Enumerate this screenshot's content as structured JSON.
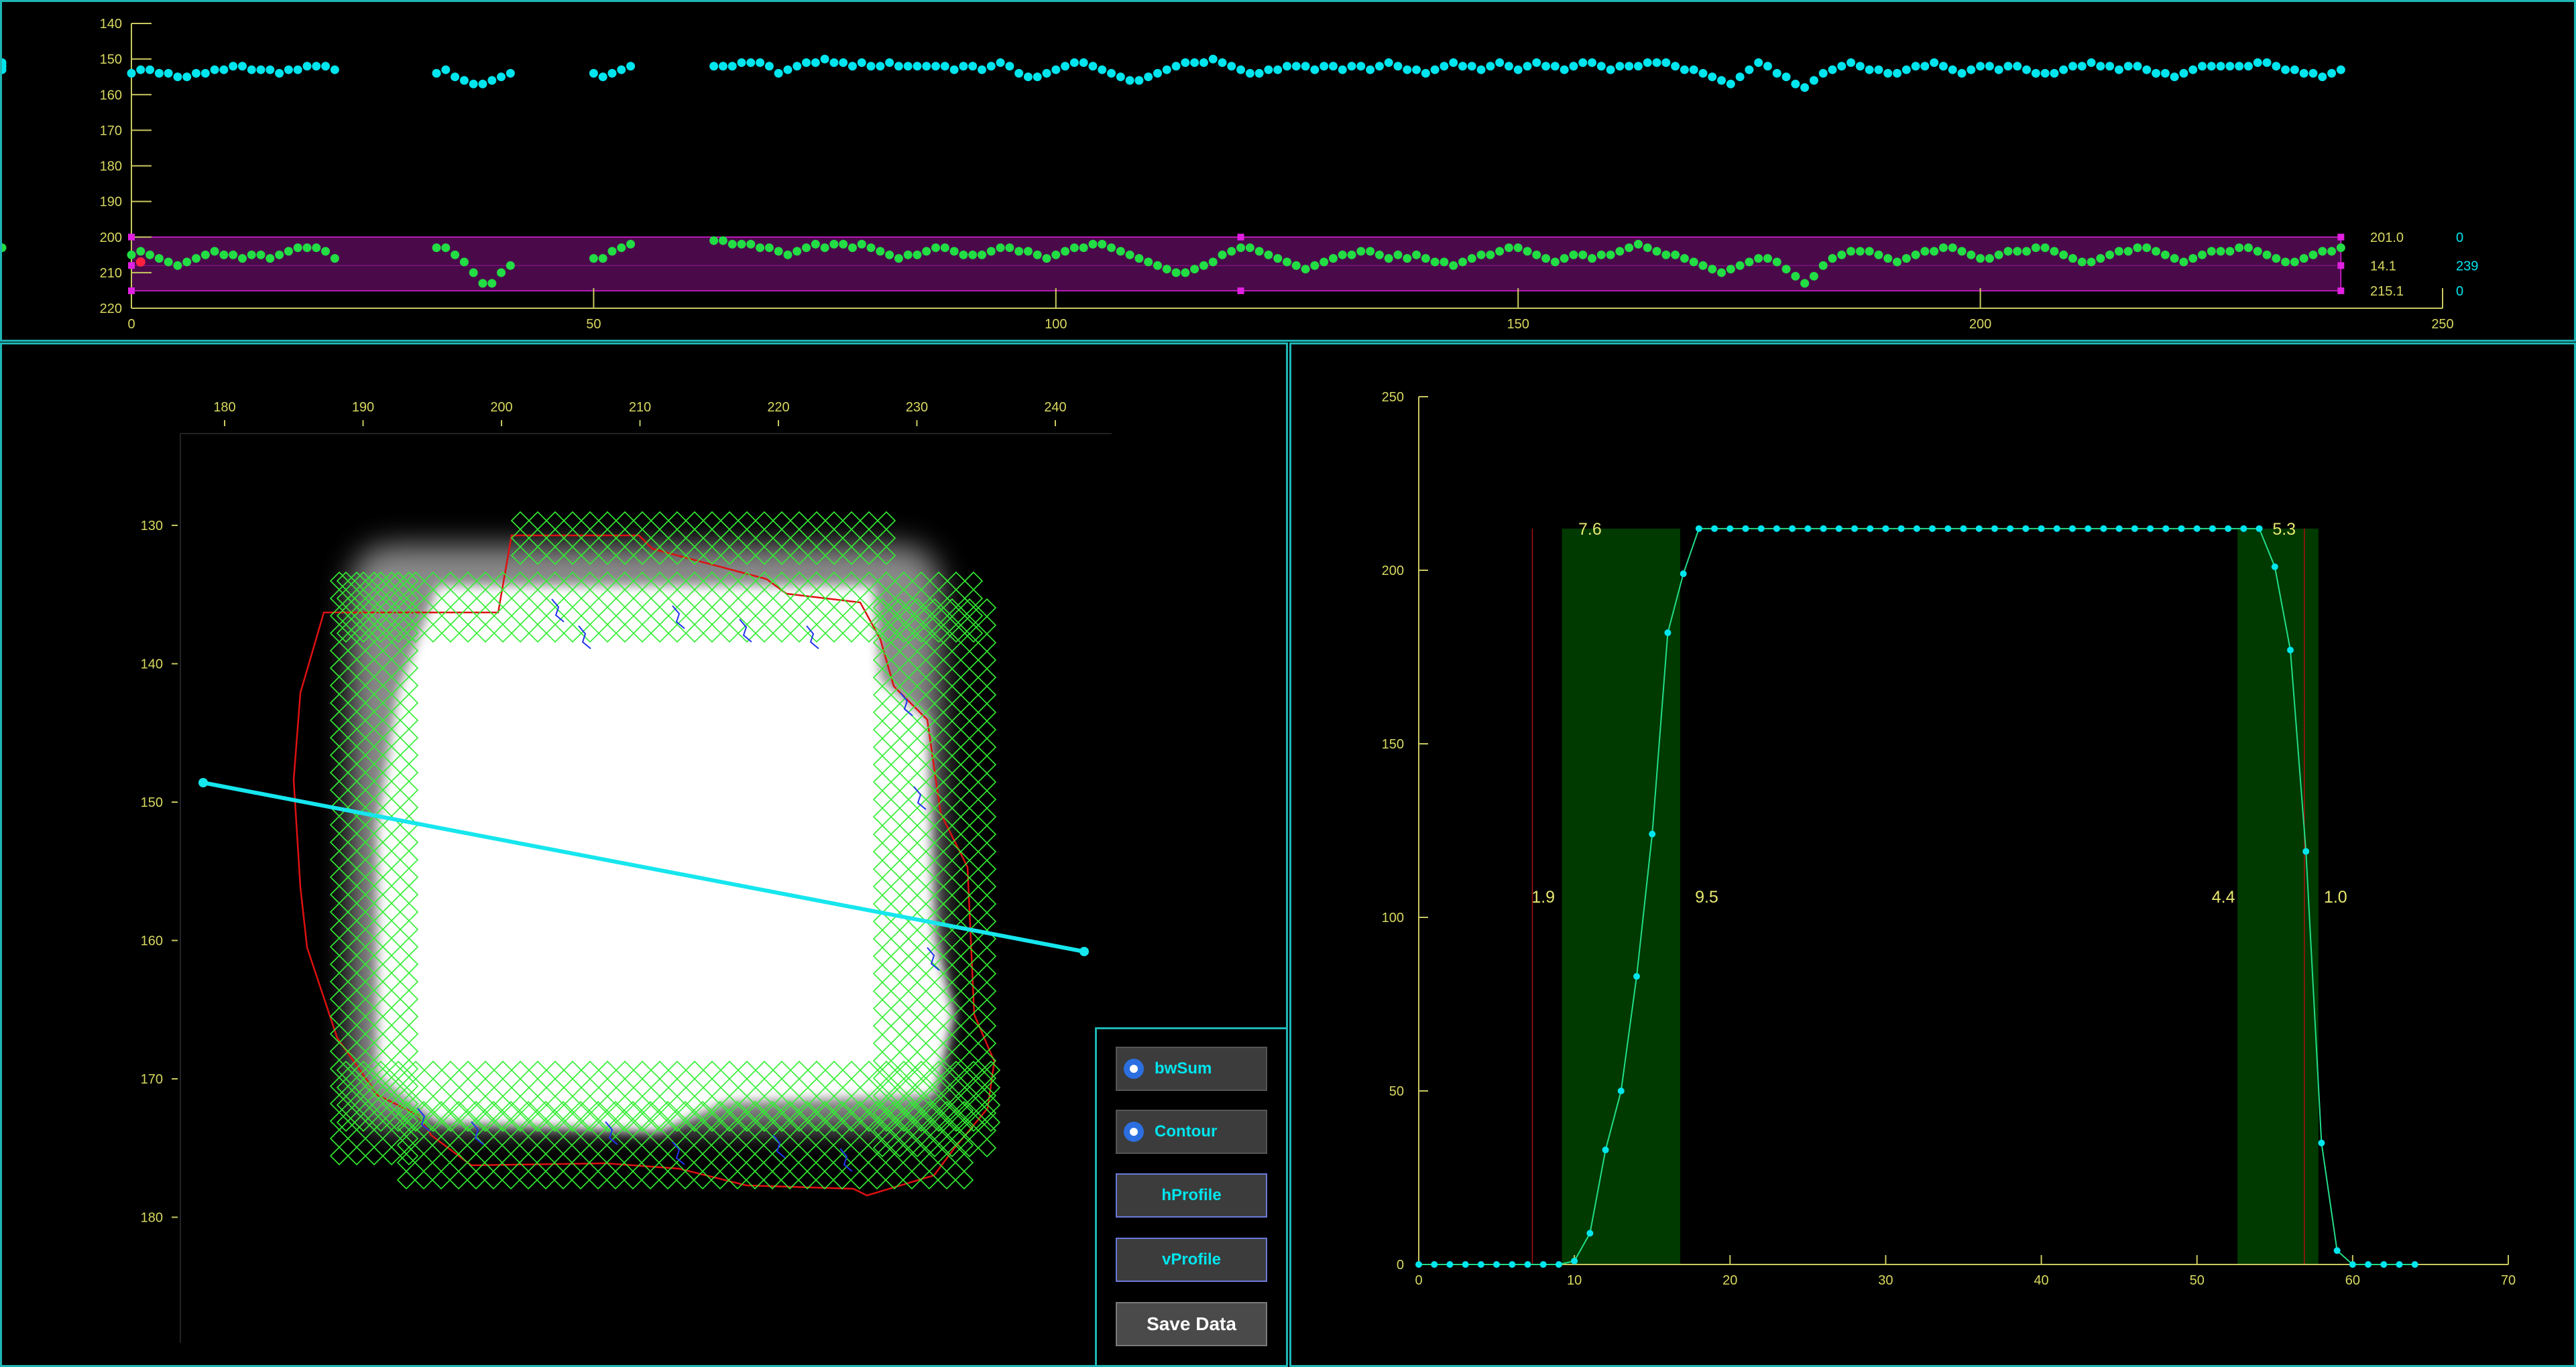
{
  "colors": {
    "panel_border": "#1fb5b5",
    "axis": "#c8c860",
    "cyan_series": "#00e5ee",
    "green_series": "#22dd44",
    "band": "#4a0a4a",
    "marker": "#e020e0",
    "green_band": "#003a00"
  },
  "top_chart": {
    "y_ticks": [
      "140",
      "150",
      "160",
      "170",
      "180",
      "190",
      "200",
      "210",
      "220"
    ],
    "x_ticks": [
      "0",
      "50",
      "100",
      "150",
      "200",
      "250"
    ],
    "right_labels": [
      {
        "value": "201.0",
        "count": "0"
      },
      {
        "value": "14.1",
        "count": "239"
      },
      {
        "value": "215.1",
        "count": "0"
      }
    ]
  },
  "image_view": {
    "x_ticks": [
      "180",
      "190",
      "200",
      "210",
      "220",
      "230",
      "240"
    ],
    "y_ticks": [
      "130",
      "140",
      "150",
      "160",
      "170",
      "180"
    ]
  },
  "controls": {
    "bwsum_label": "bwSum",
    "contour_label": "Contour",
    "hprofile_label": "hProfile",
    "vprofile_label": "vProfile",
    "save_label": "Save Data"
  },
  "profile_chart": {
    "x_ticks": [
      "0",
      "10",
      "20",
      "30",
      "40",
      "50",
      "60",
      "70"
    ],
    "y_ticks": [
      "0",
      "50",
      "100",
      "150",
      "200",
      "250"
    ],
    "annotations": {
      "left_top": "7.6",
      "left_outer": "1.9",
      "left_inner": "9.5",
      "right_top": "5.3",
      "right_inner": "4.4",
      "right_outer": "1.0"
    }
  },
  "chart_data": [
    {
      "type": "scatter",
      "x": [
        0,
        1,
        2,
        3,
        4,
        5,
        6,
        7,
        8,
        9,
        10,
        11,
        12,
        13,
        14,
        15,
        16,
        17,
        18,
        19,
        20,
        21,
        22,
        33,
        34,
        35,
        36,
        37,
        38,
        39,
        40,
        41,
        50,
        51,
        52,
        53,
        54,
        63,
        64,
        65,
        66,
        67,
        68,
        69,
        70,
        71,
        72,
        73,
        74,
        75,
        76,
        77,
        78,
        79,
        80,
        81,
        82,
        83,
        84,
        85,
        86,
        87,
        88,
        89,
        90,
        91,
        92,
        93,
        94,
        95,
        96,
        97,
        98,
        99,
        100,
        101,
        102,
        103,
        104,
        105,
        106,
        107,
        108,
        109,
        110,
        111,
        112,
        113,
        114,
        115,
        116,
        117,
        118,
        119,
        120,
        121,
        122,
        123,
        124,
        125,
        126,
        127,
        128,
        129,
        130,
        131,
        132,
        133,
        134,
        135,
        136,
        137,
        138,
        139,
        140,
        141,
        142,
        143,
        144,
        145,
        146,
        147,
        148,
        149,
        150,
        151,
        152,
        153,
        154,
        155,
        156,
        157,
        158,
        159,
        160,
        161,
        162,
        163,
        164,
        165,
        166,
        167,
        168,
        169,
        170,
        171,
        172,
        173,
        174,
        175,
        176,
        177,
        178,
        179,
        180,
        181,
        182,
        183,
        184,
        185,
        186,
        187,
        188,
        189,
        190,
        191,
        192,
        193,
        194,
        195,
        196,
        197,
        198,
        199,
        200,
        201,
        202,
        203,
        204,
        205,
        206,
        207,
        208,
        209,
        210,
        211,
        212,
        213,
        214,
        215,
        216,
        217,
        218,
        219,
        220,
        221,
        222,
        223,
        224,
        225,
        226,
        227,
        228,
        229,
        230,
        231,
        232,
        233,
        234,
        235,
        236,
        237,
        238,
        239
      ],
      "series": [
        {
          "values": [
            154,
            153,
            153,
            154,
            154,
            155,
            155,
            154,
            154,
            153,
            153,
            152,
            152,
            153,
            153,
            153,
            154,
            153,
            153,
            152,
            152,
            152,
            153,
            154,
            153,
            155,
            156,
            157,
            157,
            156,
            155,
            154,
            154,
            155,
            154,
            153,
            152,
            152,
            152,
            152,
            151,
            151,
            151,
            152,
            154,
            153,
            152,
            151,
            151,
            150,
            151,
            151,
            152,
            151,
            152,
            152,
            151,
            152,
            152,
            152,
            152,
            152,
            152,
            153,
            152,
            152,
            153,
            152,
            151,
            152,
            154,
            155,
            155,
            154,
            153,
            152,
            151,
            151,
            152,
            153,
            154,
            155,
            156,
            156,
            155,
            154,
            153,
            152,
            151,
            151,
            151,
            150,
            151,
            152,
            153,
            154,
            154,
            153,
            153,
            152,
            152,
            152,
            153,
            152,
            152,
            153,
            152,
            152,
            153,
            152,
            151,
            152,
            153,
            153,
            154,
            153,
            152,
            151,
            152,
            152,
            153,
            152,
            151,
            152,
            153,
            152,
            151,
            152,
            152,
            153,
            152,
            151,
            151,
            152,
            153,
            152,
            152,
            152,
            151,
            151,
            151,
            152,
            153,
            153,
            154,
            155,
            156,
            157,
            155,
            153,
            151,
            152,
            154,
            155,
            157,
            158,
            156,
            154,
            153,
            152,
            151,
            152,
            153,
            153,
            154,
            154,
            153,
            152,
            152,
            151,
            152,
            153,
            154,
            153,
            152,
            152,
            153,
            152,
            152,
            153,
            154,
            154,
            154,
            153,
            152,
            152,
            151,
            152,
            152,
            153,
            152,
            152,
            153,
            154,
            154,
            155,
            154,
            153,
            152,
            152,
            152,
            152,
            152,
            152,
            151,
            151,
            152,
            153,
            153,
            154,
            154,
            155,
            154,
            153,
            152,
            152,
            153,
            152,
            151,
            152
          ]
        },
        {
          "values": [
            205,
            204,
            205,
            206,
            207,
            208,
            207,
            206,
            205,
            204,
            205,
            205,
            206,
            205,
            205,
            206,
            205,
            204,
            203,
            203,
            203,
            204,
            206,
            203,
            203,
            205,
            207,
            210,
            213,
            213,
            210,
            208,
            206,
            206,
            204,
            203,
            202,
            201,
            201,
            202,
            202,
            202,
            203,
            203,
            204,
            205,
            204,
            203,
            202,
            203,
            202,
            202,
            203,
            202,
            203,
            204,
            205,
            206,
            205,
            205,
            204,
            203,
            203,
            204,
            205,
            205,
            205,
            204,
            203,
            203,
            204,
            204,
            205,
            206,
            205,
            204,
            203,
            203,
            202,
            202,
            203,
            204,
            205,
            206,
            207,
            208,
            209,
            210,
            210,
            209,
            208,
            207,
            205,
            204,
            203,
            203,
            204,
            205,
            206,
            207,
            208,
            209,
            208,
            207,
            206,
            205,
            205,
            204,
            204,
            205,
            206,
            205,
            206,
            205,
            206,
            207,
            207,
            208,
            207,
            206,
            205,
            205,
            204,
            203,
            203,
            204,
            205,
            206,
            207,
            206,
            205,
            205,
            206,
            205,
            205,
            204,
            203,
            202,
            203,
            204,
            205,
            205,
            206,
            207,
            208,
            209,
            210,
            209,
            208,
            207,
            206,
            206,
            207,
            209,
            211,
            213,
            211,
            208,
            206,
            205,
            204,
            204,
            204,
            205,
            206,
            207,
            206,
            205,
            204,
            204,
            203,
            203,
            204,
            205,
            206,
            206,
            205,
            204,
            204,
            204,
            203,
            203,
            204,
            205,
            206,
            207,
            207,
            206,
            205,
            204,
            204,
            203,
            203,
            204,
            205,
            206,
            207,
            206,
            205,
            204,
            204,
            204,
            203,
            203,
            204,
            205,
            206,
            207,
            207,
            206,
            205,
            204,
            204,
            203,
            203
          ]
        }
      ],
      "xlim": [
        0,
        250
      ],
      "ylim": [
        220,
        140
      ]
    },
    {
      "type": "line",
      "x": [
        0,
        1,
        2,
        3,
        4,
        5,
        6,
        7,
        8,
        9,
        10,
        11,
        12,
        13,
        14,
        15,
        16,
        17,
        18,
        19,
        20,
        21,
        22,
        23,
        24,
        25,
        26,
        27,
        28,
        29,
        30,
        31,
        32,
        33,
        34,
        35,
        36,
        37,
        38,
        39,
        40,
        41,
        42,
        43,
        44,
        45,
        46,
        47,
        48,
        49,
        50,
        51,
        52,
        53,
        54,
        55,
        56,
        57,
        58,
        59,
        60,
        61,
        62,
        63,
        64
      ],
      "values": [
        0,
        0,
        0,
        0,
        0,
        0,
        0,
        0,
        0,
        0,
        1,
        9,
        33,
        50,
        83,
        124,
        182,
        199,
        212,
        212,
        212,
        212,
        212,
        212,
        212,
        212,
        212,
        212,
        212,
        212,
        212,
        212,
        212,
        212,
        212,
        212,
        212,
        212,
        212,
        212,
        212,
        212,
        212,
        212,
        212,
        212,
        212,
        212,
        212,
        212,
        212,
        212,
        212,
        212,
        212,
        201,
        177,
        119,
        35,
        4,
        0,
        0,
        0,
        0,
        0
      ],
      "xlim": [
        0,
        70
      ],
      "ylim": [
        0,
        250
      ]
    }
  ]
}
